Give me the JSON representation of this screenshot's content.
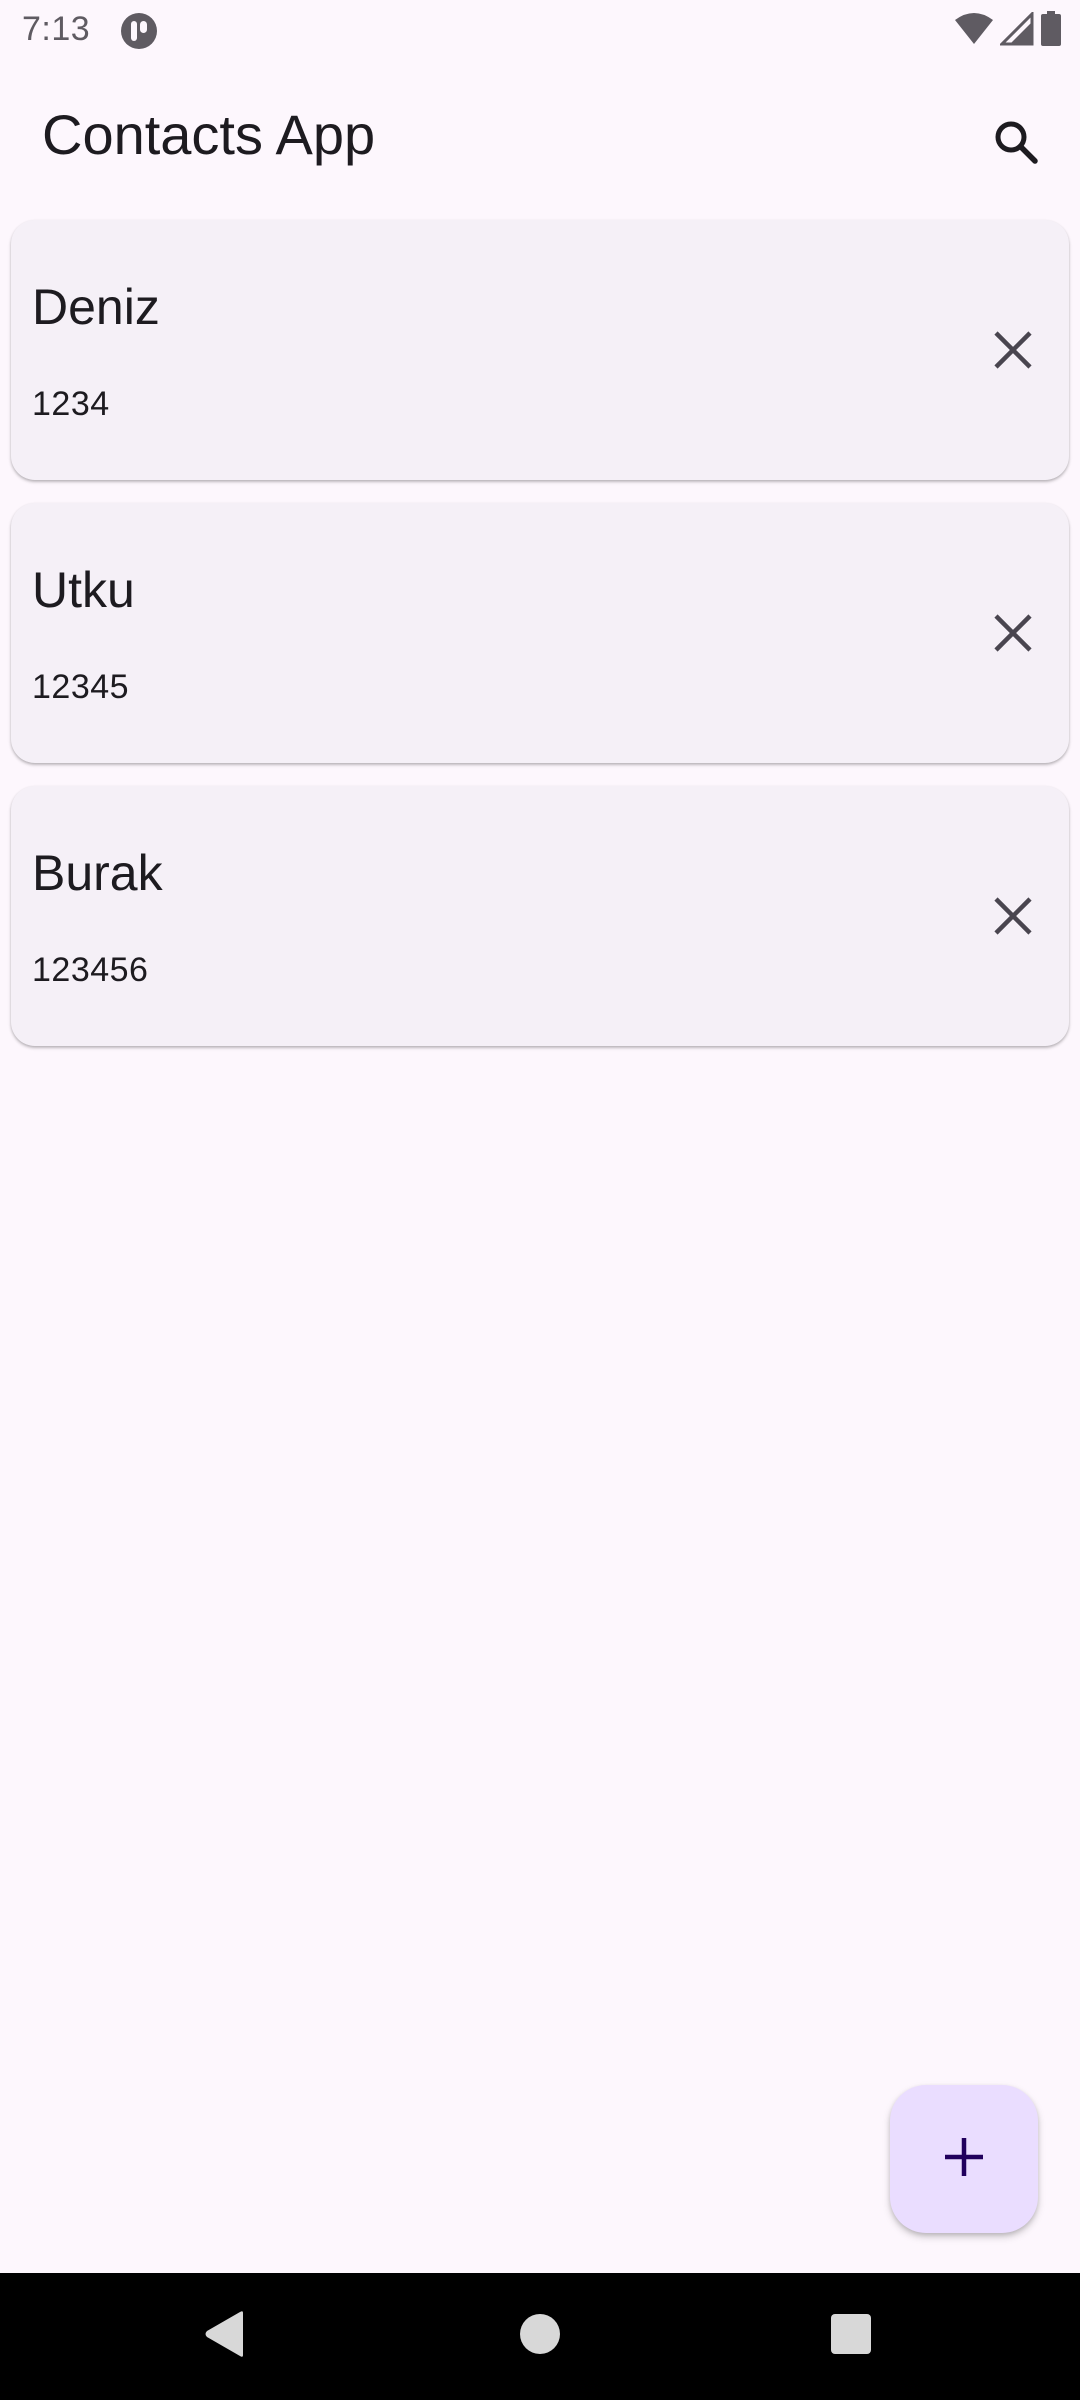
{
  "status_bar": {
    "time": "7:13"
  },
  "app_bar": {
    "title": "Contacts App"
  },
  "contacts": [
    {
      "name": "Deniz",
      "phone": "1234"
    },
    {
      "name": "Utku",
      "phone": "12345"
    },
    {
      "name": "Burak",
      "phone": "123456"
    }
  ],
  "icons": {
    "search": "search-icon",
    "delete": "close-icon",
    "fab": "plus-icon",
    "nav_back": "back-triangle-icon",
    "nav_home": "home-circle-icon",
    "nav_recents": "recents-square-icon"
  },
  "colors": {
    "background": "#fdf7fd",
    "card": "#f5f0f7",
    "fab": "#eaddff",
    "text": "#1d1b20",
    "icon": "#49454f"
  }
}
